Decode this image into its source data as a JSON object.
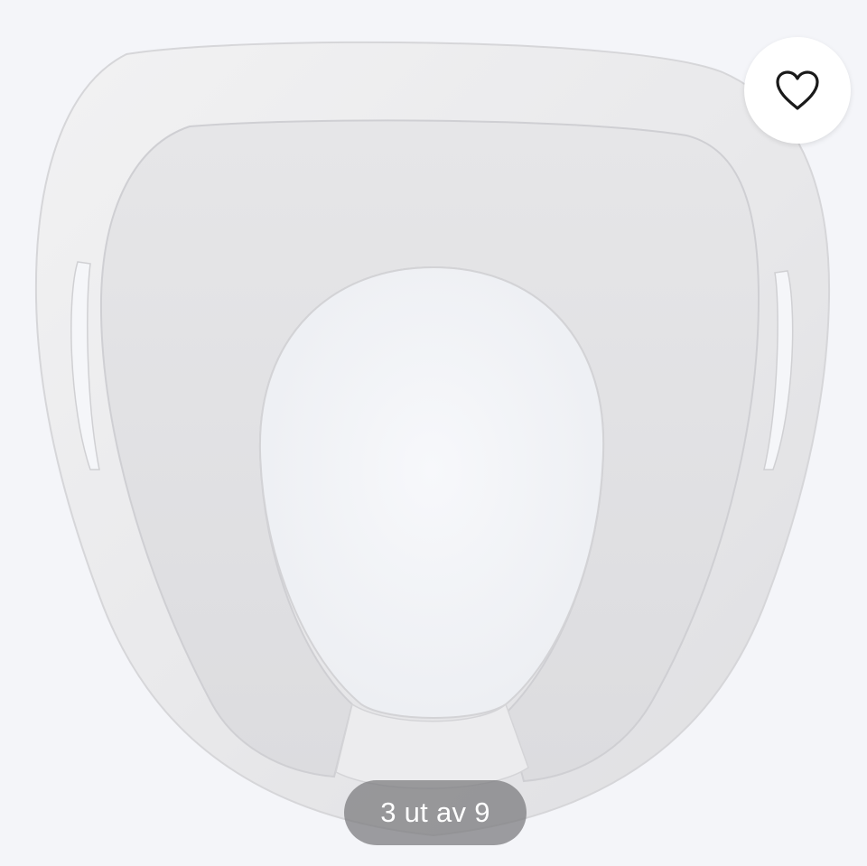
{
  "gallery": {
    "counter_text": "3 ut av 9",
    "current_index": 3,
    "total_images": 9
  },
  "favorite": {
    "icon": "heart-outline-icon"
  },
  "colors": {
    "background": "#f4f5f9",
    "pill_background": "#78787c",
    "pill_text": "#ffffff",
    "icon_stroke": "#1a1a1a"
  }
}
